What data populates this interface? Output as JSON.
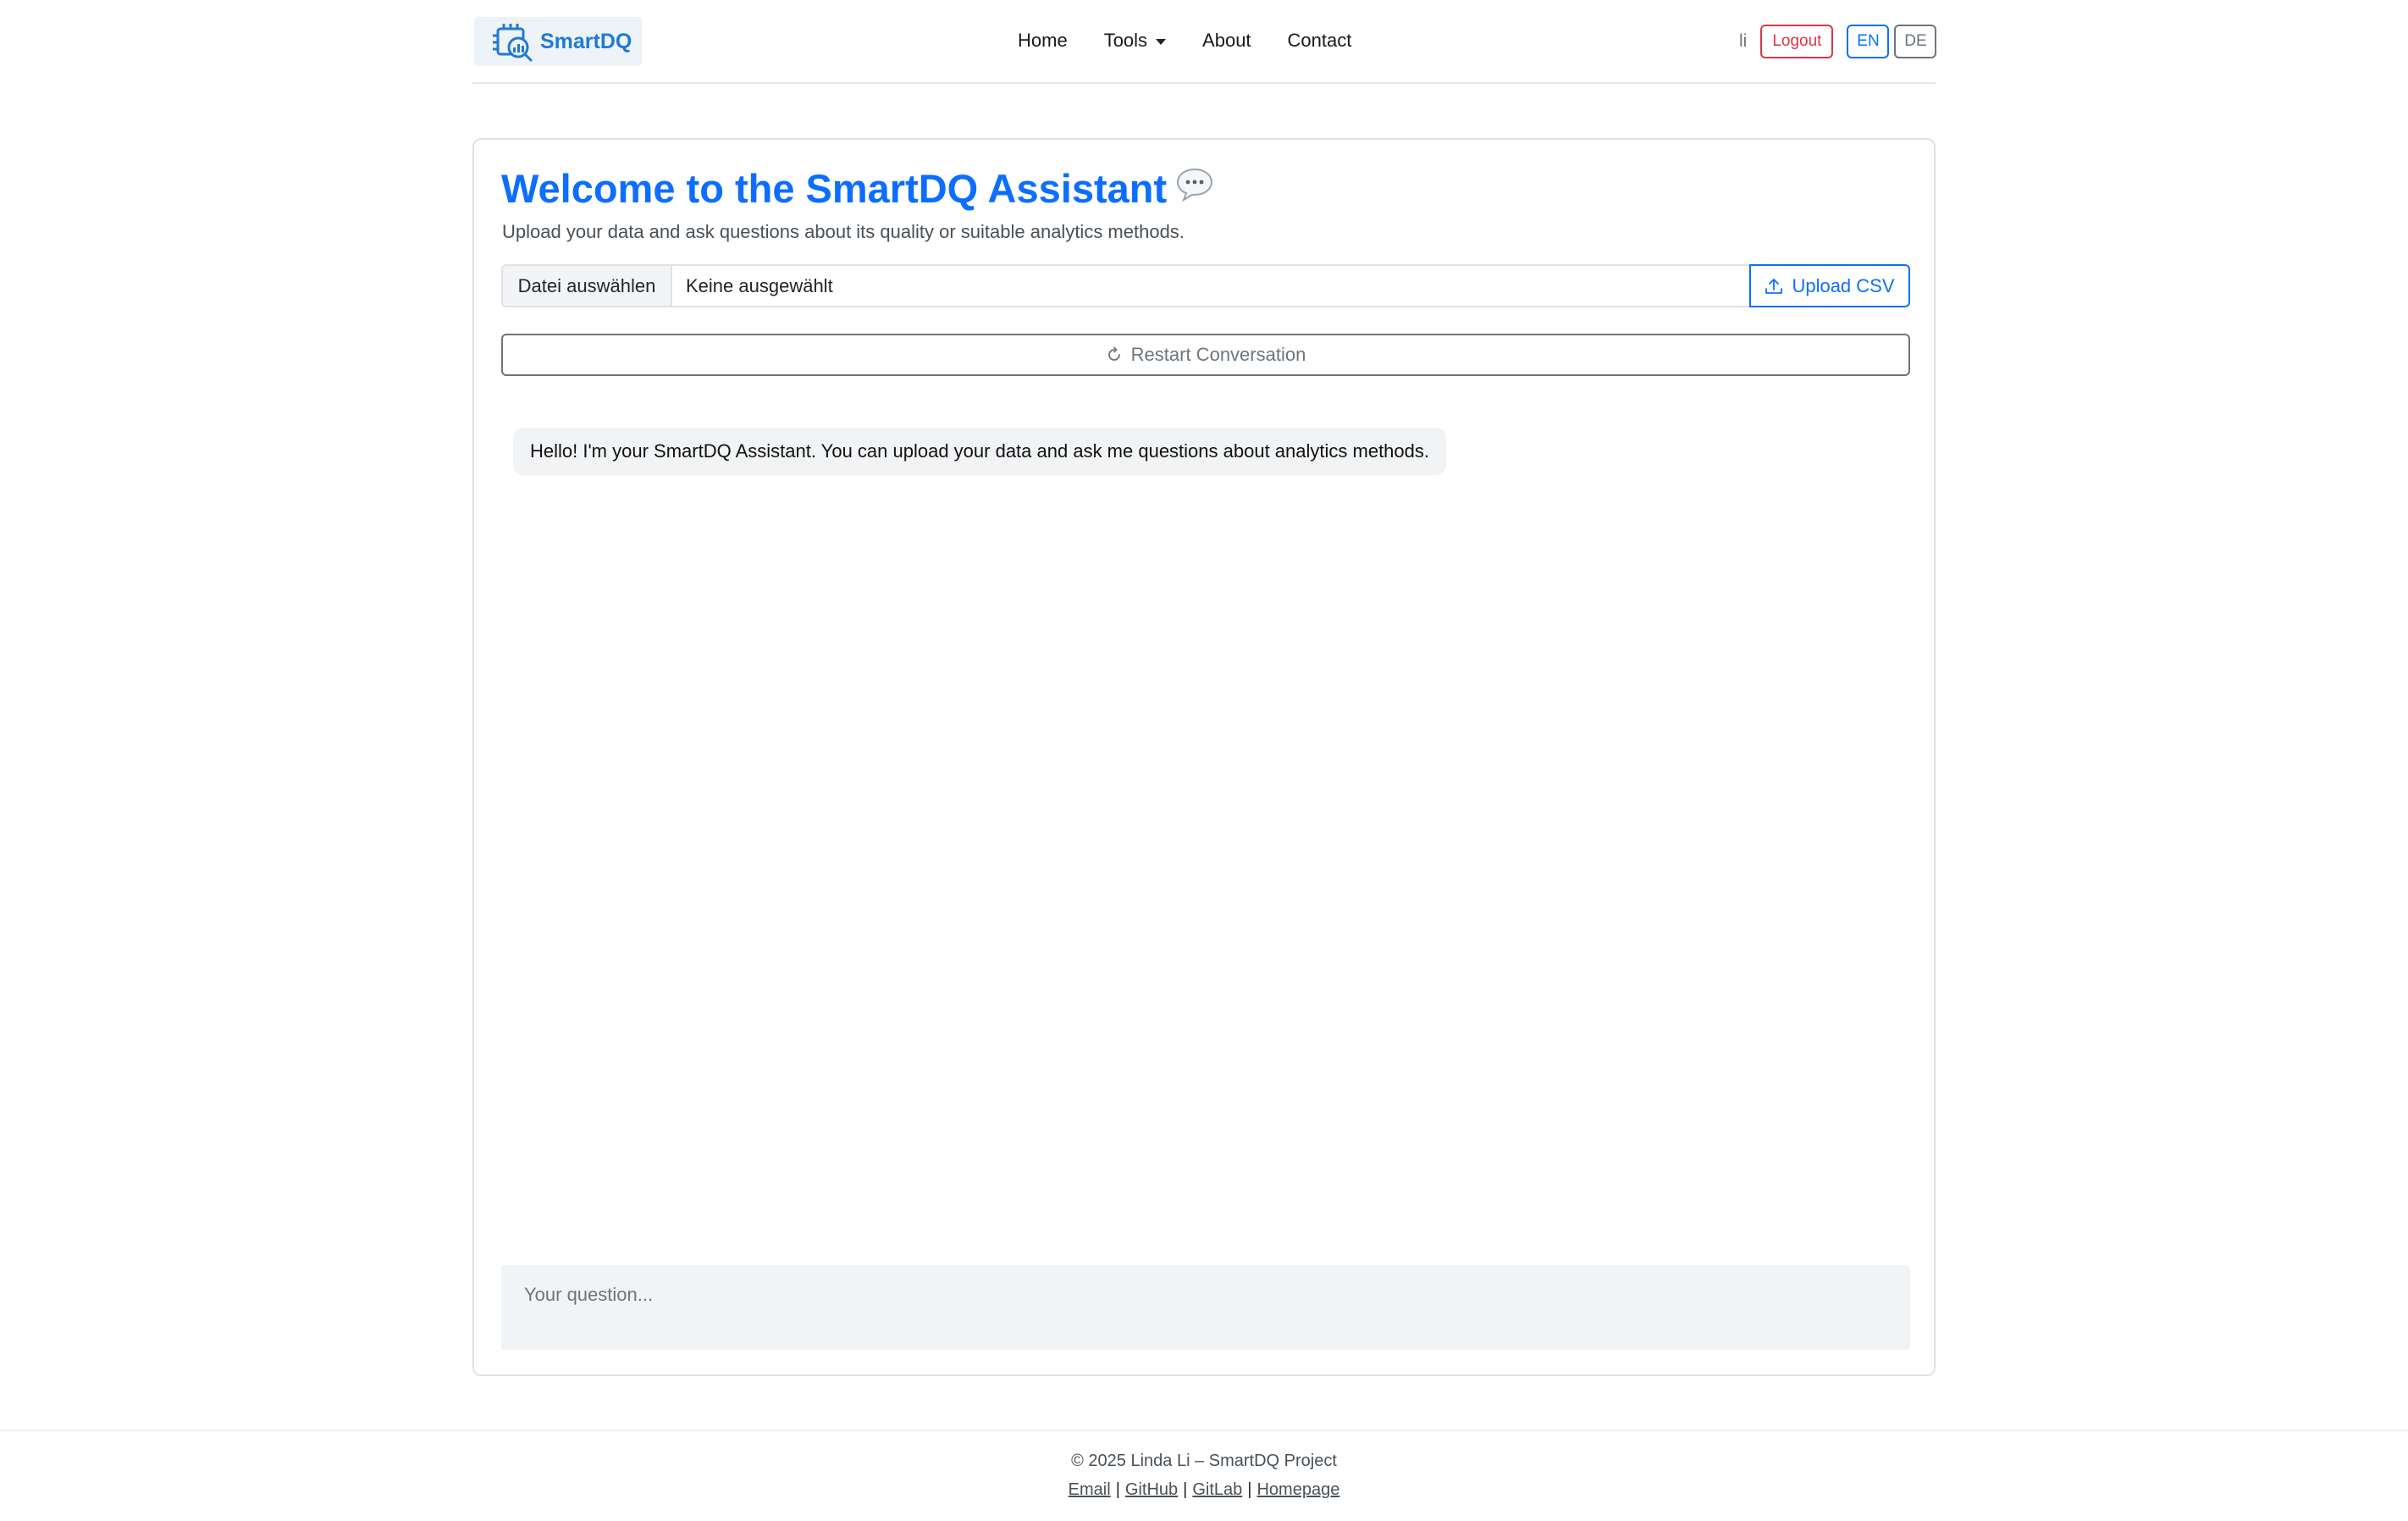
{
  "brand": {
    "name": "SmartDQ",
    "logo_icon": "chip-magnifier-chart-icon",
    "color": "#1e7ad6"
  },
  "nav": {
    "links": [
      {
        "label": "Home"
      },
      {
        "label": "Tools"
      },
      {
        "label": "About"
      },
      {
        "label": "Contact"
      }
    ],
    "user": "li",
    "logout_label": "Logout",
    "lang_en": "EN",
    "lang_de": "DE"
  },
  "main": {
    "title": "Welcome to the SmartDQ Assistant",
    "title_emoji": "💬",
    "subtitle": "Upload your data and ask questions about its quality or suitable analytics methods.",
    "file_button": "Datei auswählen",
    "file_status": "Keine ausgewählt",
    "upload_label": "Upload CSV",
    "restart_label": "Restart Conversation",
    "messages": [
      {
        "role": "assistant",
        "text": "Hello! I'm your SmartDQ Assistant. You can upload your data and ask me questions about analytics methods."
      }
    ],
    "question_placeholder": "Your question..."
  },
  "footer": {
    "copyright": "© 2025 Linda Li – SmartDQ Project",
    "links": [
      {
        "label": "Email"
      },
      {
        "label": "GitHub"
      },
      {
        "label": "GitLab"
      },
      {
        "label": "Homepage"
      }
    ],
    "separator": "|"
  },
  "colors": {
    "primary": "#0d6efd",
    "danger": "#dc3545",
    "secondary": "#6c757d"
  }
}
